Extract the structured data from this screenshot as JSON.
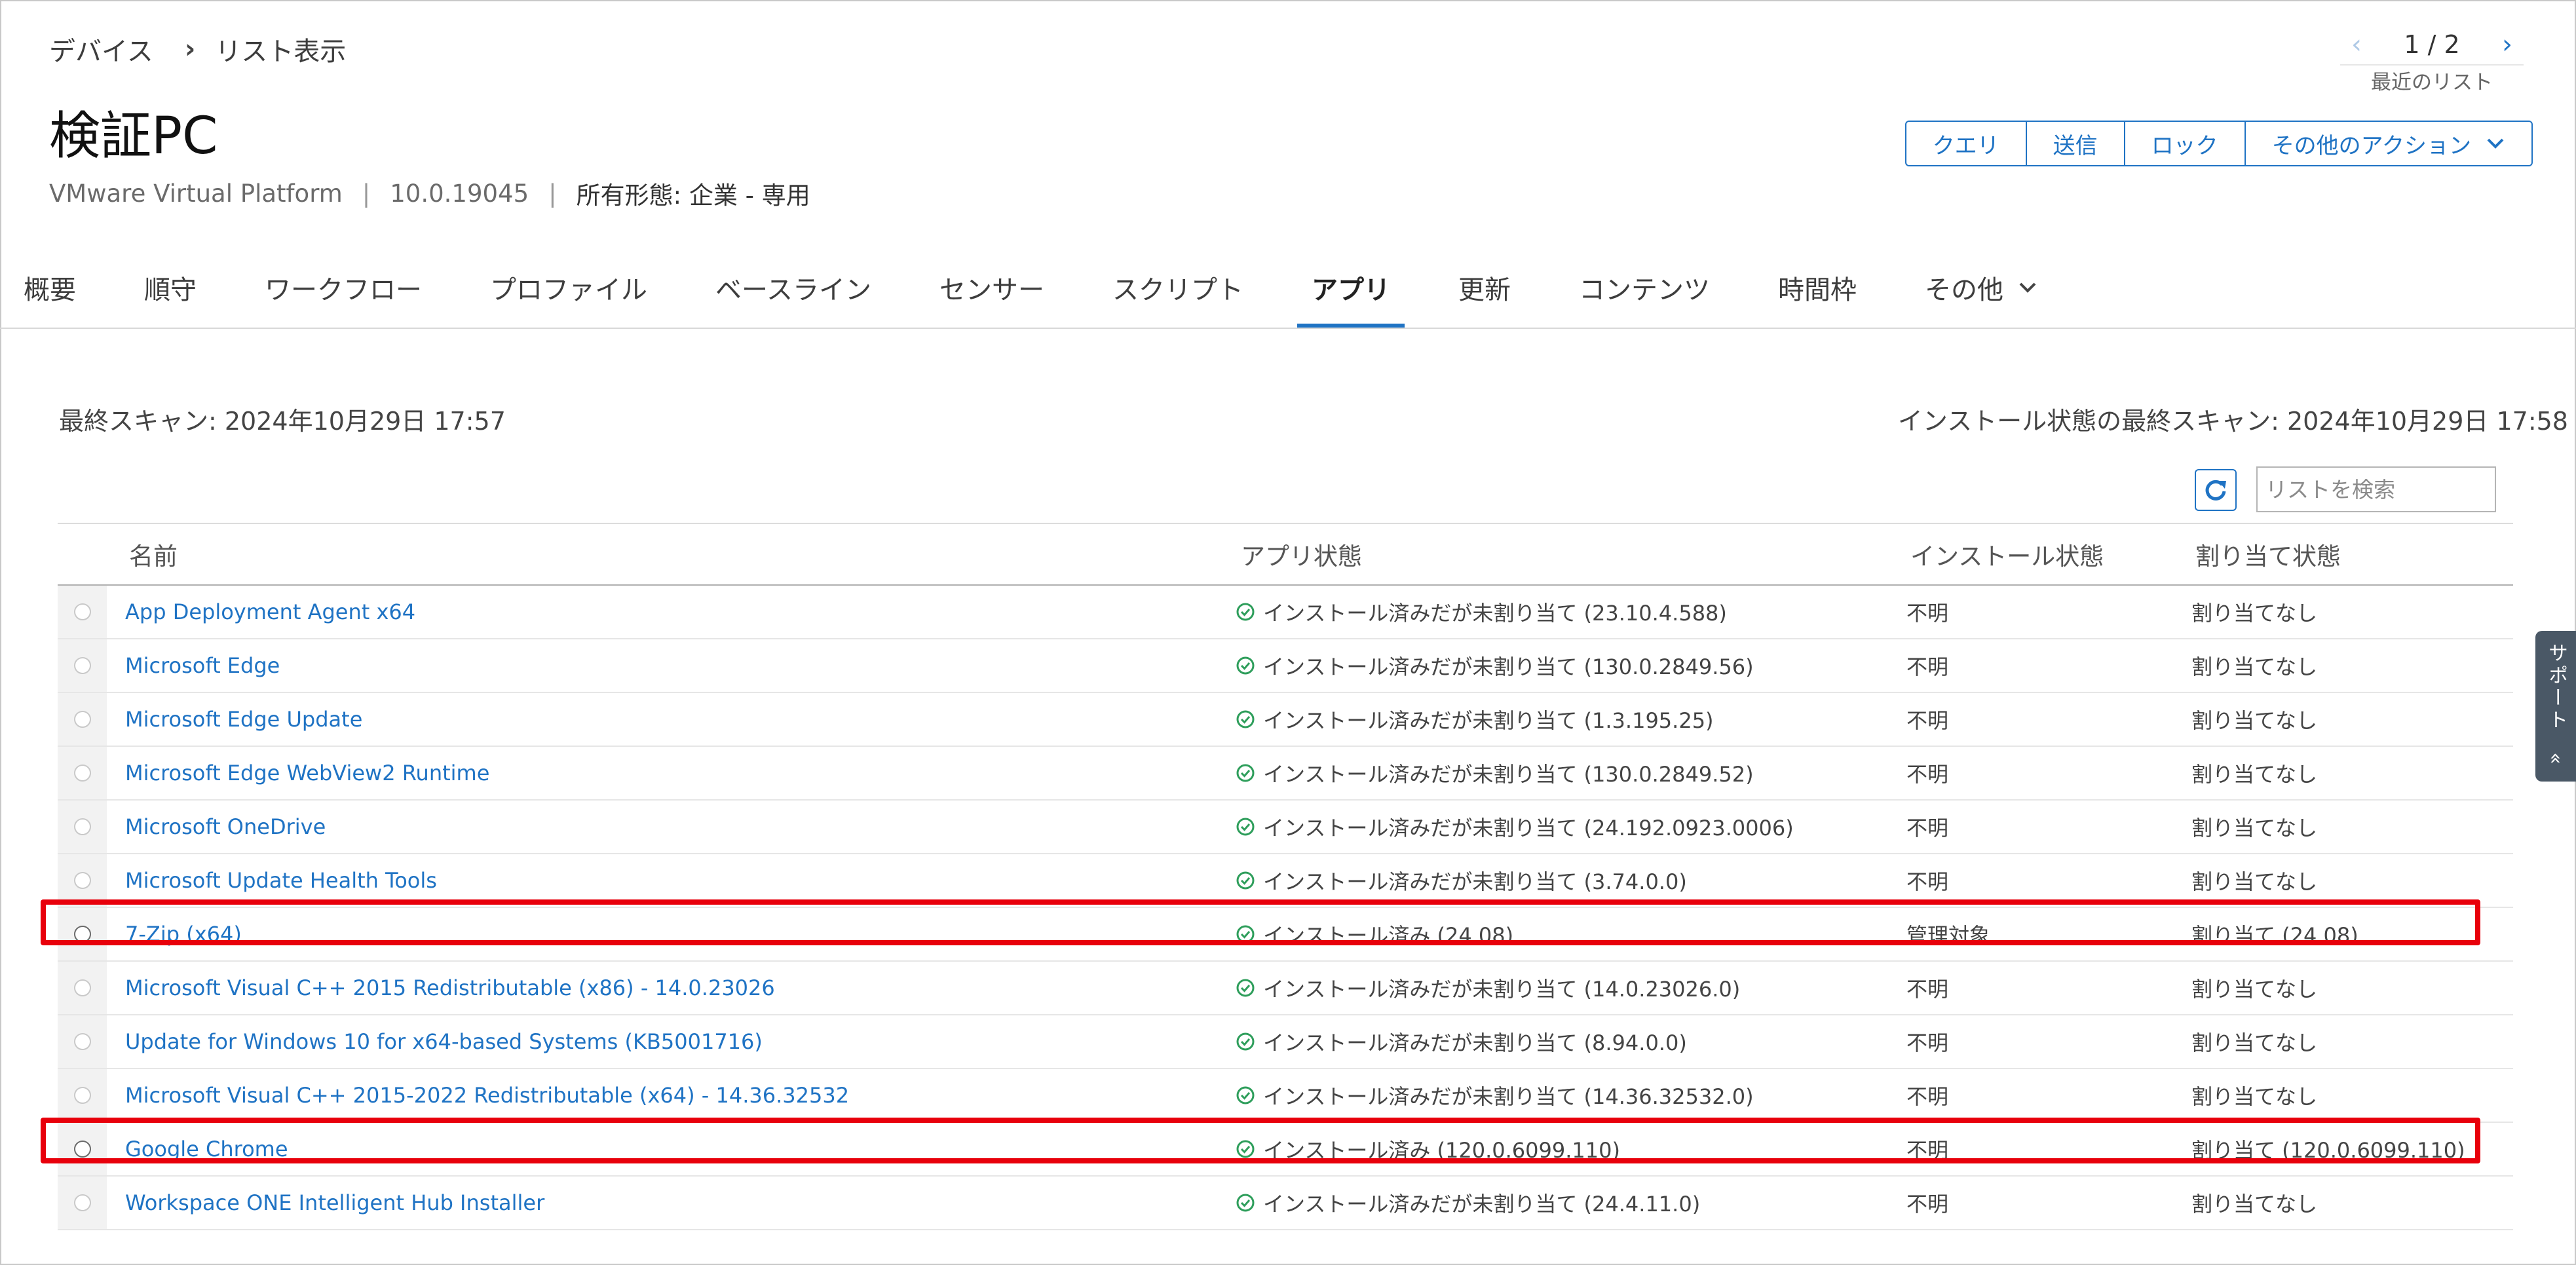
{
  "breadcrumb": {
    "parent": "デバイス",
    "separator": "›",
    "current": "リスト表示"
  },
  "device": {
    "title": "検証PC",
    "model": "VMware Virtual Platform",
    "os_version": "10.0.19045",
    "ownership": "所有形態: 企業 - 専用"
  },
  "pager": {
    "prev": "‹",
    "next": "›",
    "position": "1 / 2",
    "recent_label": "最近のリスト"
  },
  "actions": {
    "query": "クエリ",
    "send": "送信",
    "lock": "ロック",
    "more": "その他のアクション"
  },
  "tabs": [
    "概要",
    "順守",
    "ワークフロー",
    "プロファイル",
    "ベースライン",
    "センサー",
    "スクリプト",
    "アプリ",
    "更新",
    "コンテンツ",
    "時間枠",
    "その他"
  ],
  "active_tab": "アプリ",
  "scan": {
    "last_scan": "最終スキャン: 2024年10月29日 17:57",
    "install_last_scan": "インストール状態の最終スキャン: 2024年10月29日 17:58"
  },
  "search": {
    "placeholder": "リストを検索",
    "value": ""
  },
  "table": {
    "headers": {
      "name": "名前",
      "app_status": "アプリ状態",
      "install_status": "インストール状態",
      "assign_status": "割り当て状態"
    },
    "rows": [
      {
        "name": "App Deployment Agent x64",
        "app_status": "インストール済みだが未割り当て (23.10.4.588)",
        "install_status": "不明",
        "assign_status": "割り当てなし"
      },
      {
        "name": "Microsoft Edge",
        "app_status": "インストール済みだが未割り当て (130.0.2849.56)",
        "install_status": "不明",
        "assign_status": "割り当てなし"
      },
      {
        "name": "Microsoft Edge Update",
        "app_status": "インストール済みだが未割り当て (1.3.195.25)",
        "install_status": "不明",
        "assign_status": "割り当てなし"
      },
      {
        "name": "Microsoft Edge WebView2 Runtime",
        "app_status": "インストール済みだが未割り当て (130.0.2849.52)",
        "install_status": "不明",
        "assign_status": "割り当てなし"
      },
      {
        "name": "Microsoft OneDrive",
        "app_status": "インストール済みだが未割り当て (24.192.0923.0006)",
        "install_status": "不明",
        "assign_status": "割り当てなし"
      },
      {
        "name": "Microsoft Update Health Tools",
        "app_status": "インストール済みだが未割り当て (3.74.0.0)",
        "install_status": "不明",
        "assign_status": "割り当てなし"
      },
      {
        "name": "7-Zip (x64)",
        "app_status": "インストール済み (24.08)",
        "install_status": "管理対象",
        "assign_status": "割り当て (24.08)"
      },
      {
        "name": "Microsoft Visual C++ 2015 Redistributable (x86) - 14.0.23026",
        "app_status": "インストール済みだが未割り当て (14.0.23026.0)",
        "install_status": "不明",
        "assign_status": "割り当てなし"
      },
      {
        "name": "Update for Windows 10 for x64-based Systems (KB5001716)",
        "app_status": "インストール済みだが未割り当て (8.94.0.0)",
        "install_status": "不明",
        "assign_status": "割り当てなし"
      },
      {
        "name": "Microsoft Visual C++ 2015-2022 Redistributable (x64) - 14.36.32532",
        "app_status": "インストール済みだが未割り当て (14.36.32532.0)",
        "install_status": "不明",
        "assign_status": "割り当てなし"
      },
      {
        "name": "Google Chrome",
        "app_status": "インストール済み (120.0.6099.110)",
        "install_status": "不明",
        "assign_status": "割り当て (120.0.6099.110)"
      },
      {
        "name": "Workspace ONE Intelligent Hub Installer",
        "app_status": "インストール済みだが未割り当て (24.4.11.0)",
        "install_status": "不明",
        "assign_status": "割り当てなし"
      }
    ]
  },
  "support": {
    "label": "サポート",
    "collapse_icon": "double-chevron-icon"
  },
  "colors": {
    "accent": "#1f73c4",
    "highlight": "#e8000b",
    "ok": "#2e9e5b"
  }
}
